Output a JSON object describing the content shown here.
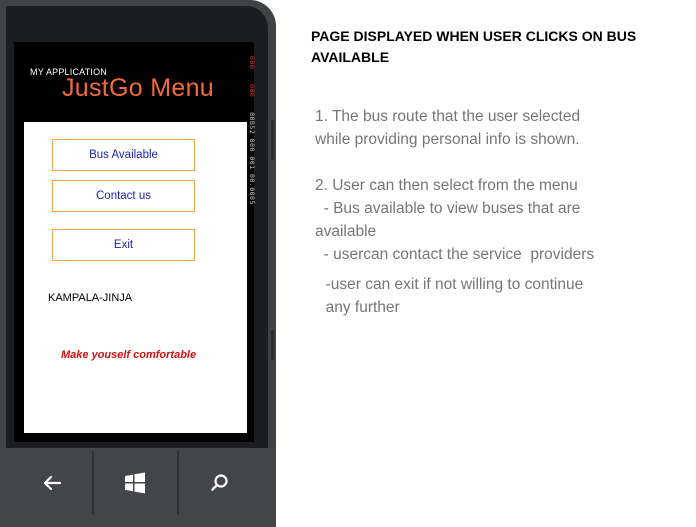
{
  "app": {
    "small_title": "MY APPLICATION",
    "title": "JustGo Menu",
    "counter": {
      "first": "000",
      "second": "000",
      "rest": "00B52 000 001 00.0005"
    }
  },
  "menu": {
    "bus_available": "Bus Available",
    "contact_us": "Contact us",
    "exit": "Exit"
  },
  "route": "KAMPALA-JINJA",
  "tagline": "Make youself comfortable",
  "nav": {
    "back_icon": "back-arrow-icon",
    "start_icon": "windows-start-icon",
    "search_icon": "search-icon"
  },
  "colors": {
    "title_accent": "#f26a3a",
    "button_border": "#f4a850",
    "button_text": "#1b1fa8",
    "tagline": "#d90f0f",
    "description_text": "#767676"
  },
  "description": {
    "title": "PAGE DISPLAYED WHEN USER CLICKS ON BUS AVAILABLE",
    "item1_line1": "1. The bus route that the user selected",
    "item1_line2": "while providing personal info is shown.",
    "item2_line1": "2. User can then select from the menu",
    "item2_line2": "  - Bus available to view buses that are",
    "item2_line3": "available",
    "item2_line4": "  - usercan contact the service  providers",
    "item2_line5": "  -user can exit if not willing to continue",
    "item2_line6": "  any further"
  }
}
